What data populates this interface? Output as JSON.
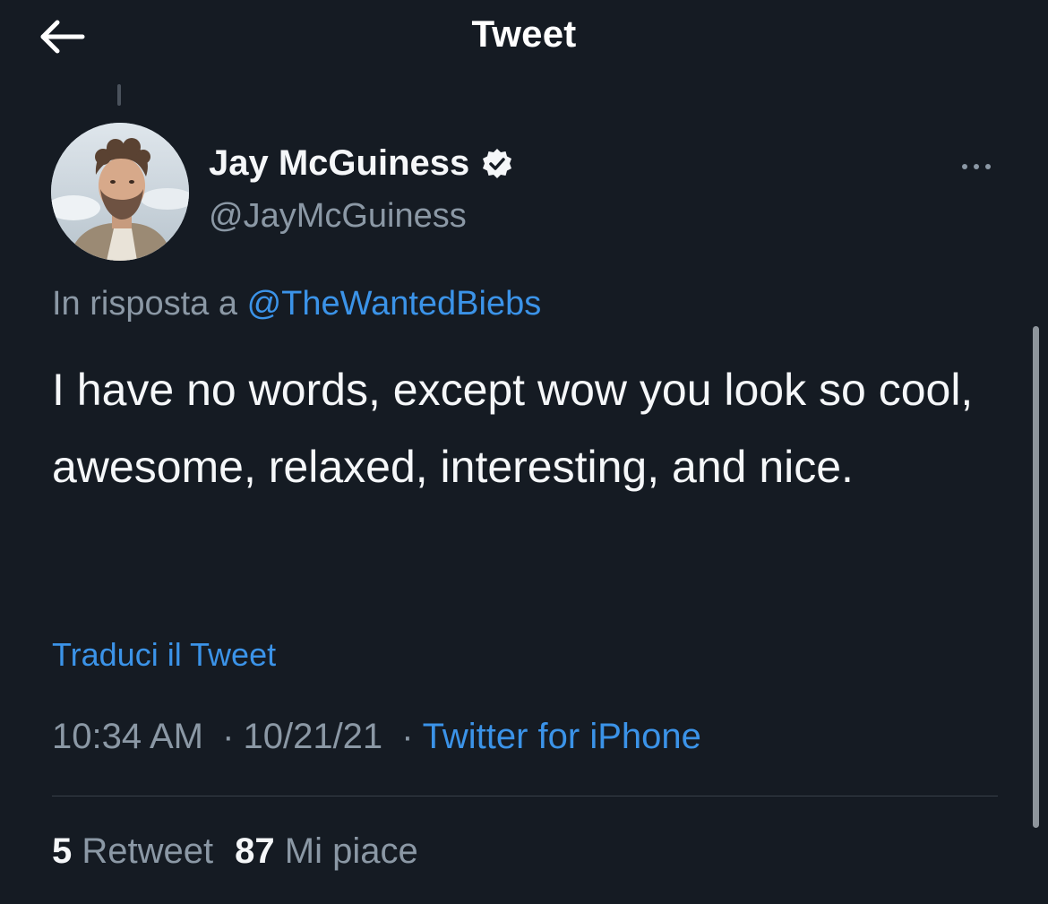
{
  "header": {
    "title": "Tweet",
    "back_icon": "arrow-left-icon"
  },
  "author": {
    "display_name": "Jay McGuiness",
    "handle": "@JayMcGuiness",
    "verified_icon": "verified-badge-icon"
  },
  "reply": {
    "prefix": "In risposta a",
    "mention": "@TheWantedBiebs"
  },
  "tweet": {
    "text": "I have no words, except wow you look so cool, awesome, relaxed, interesting, and nice."
  },
  "translate_label": "Traduci il Tweet",
  "meta": {
    "time": "10:34 AM",
    "separator": "·",
    "date": "10/21/21",
    "source": "Twitter for iPhone"
  },
  "stats": {
    "retweets_count": "5",
    "retweets_label": "Retweet",
    "likes_count": "87",
    "likes_label": "Mi piace"
  },
  "colors": {
    "background": "#151b23",
    "link": "#3b93e8",
    "secondary_text": "#8b98a5",
    "primary_text": "#f5f7f9"
  }
}
